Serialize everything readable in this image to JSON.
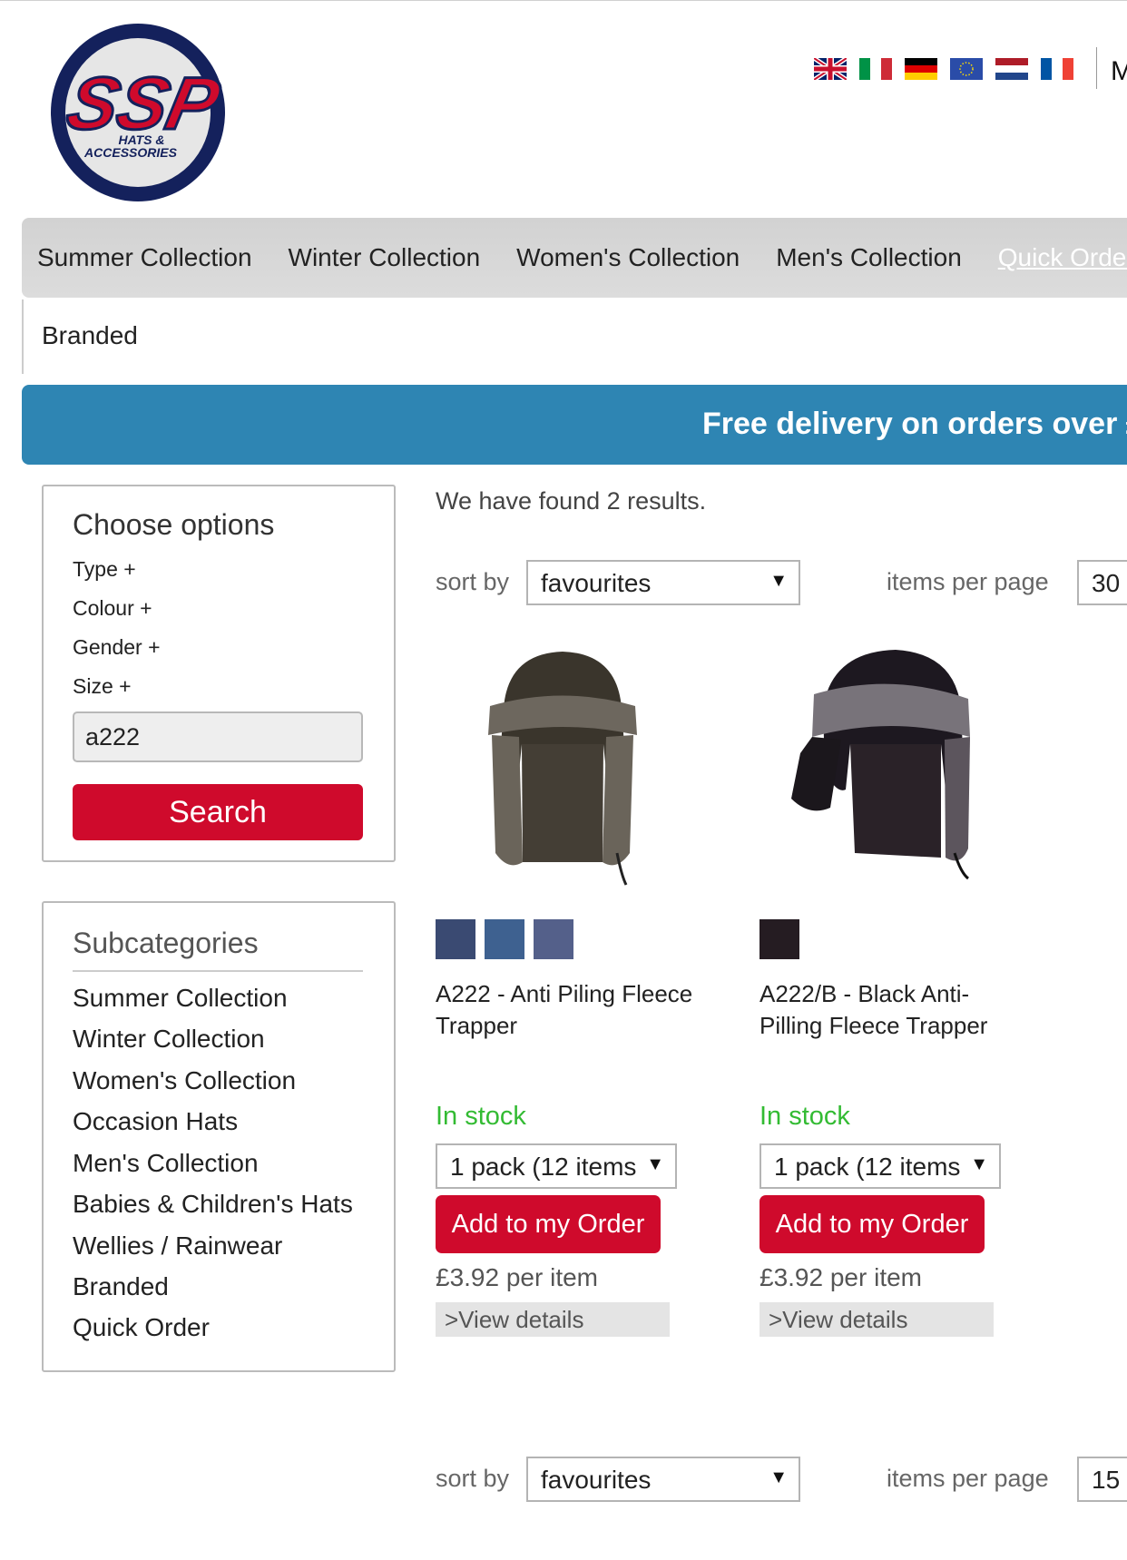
{
  "brand": {
    "logo_text": "SSP",
    "logo_subtext": "HATS & ACCESSORIES",
    "colors": {
      "navy": "#14215c",
      "red": "#cf0a2c",
      "blue_banner": "#2e85b3"
    }
  },
  "languages": [
    "en-flag-icon",
    "it-flag-icon",
    "de-flag-icon",
    "eu-flag-icon",
    "nl-flag-icon",
    "fr-flag-icon"
  ],
  "header": {
    "cut_text": "M"
  },
  "nav": {
    "items": [
      "Summer Collection",
      "Winter Collection",
      "Women's Collection",
      "Men's Collection"
    ],
    "quick": "Quick Order",
    "sub": "Branded"
  },
  "banner": {
    "text": "Free delivery on orders over £"
  },
  "sidebar": {
    "options_title": "Choose options",
    "filters": [
      "Type +",
      "Colour +",
      "Gender +",
      "Size +"
    ],
    "search_value": "a222",
    "search_button": "Search",
    "subcategories_title": "Subcategories",
    "subcategories": [
      "Summer Collection",
      "Winter Collection",
      "Women's Collection",
      "Occasion Hats",
      "Men's Collection",
      "Babies & Children's Hats",
      "Wellies / Rainwear",
      "Branded",
      "Quick Order"
    ]
  },
  "main": {
    "results_text": "We have found 2 results.",
    "sort_label": "sort by",
    "sort_value": "favourites",
    "ipp_label": "items per page",
    "ipp_top": "30",
    "ipp_bottom": "15",
    "arrow": "▼"
  },
  "products": [
    {
      "name": "A222 - Anti Piling Fleece Trapper",
      "swatches": [
        "#3a4a72",
        "#3e6190",
        "#54608a"
      ],
      "stock": "In stock",
      "pack": "1 pack (12 items",
      "button": "Add to my Order",
      "price": "£3.92 per item",
      "details": ">View details"
    },
    {
      "name": "A222/B - Black Anti-Pilling Fleece Trapper",
      "swatches": [
        "#251c22"
      ],
      "stock": "In stock",
      "pack": "1 pack (12 items",
      "button": "Add to my Order",
      "price": "£3.92 per item",
      "details": ">View details"
    }
  ]
}
